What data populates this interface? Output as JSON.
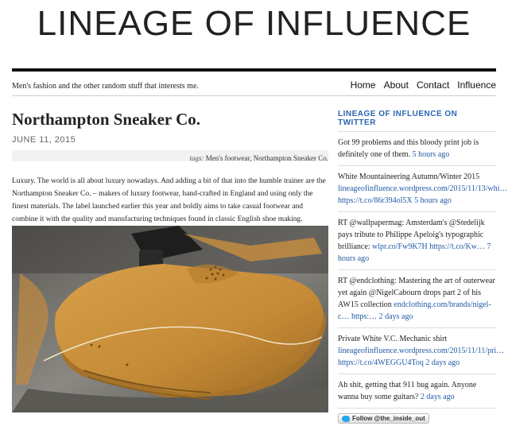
{
  "site": {
    "title": "LINEAGE OF INFLUENCE",
    "tagline": "Men's fashion and the other random stuff that interests me."
  },
  "nav": {
    "items": [
      "Home",
      "About",
      "Contact",
      "Influence"
    ]
  },
  "post": {
    "title": "Northampton Sneaker Co.",
    "date": "JUNE 11, 2015",
    "tags_label": "tags:",
    "tags": "Men's footwear, Northampton Sneaker Co.",
    "body": "Luxury. The world is all about luxury nowadays. And adding a bit of that into the humble trainer are the Northampton Sneaker Co. – makers of luxury footwear, hand-crafted in England and using only the finest materials. The label launched earlier this year and boldly aims to take casual footwear and combine it with the quality and manufacturing techniques found in classic English shoe making."
  },
  "sidebar": {
    "title": "LINEAGE OF INFLUENCE ON TWITTER",
    "tweets": [
      {
        "text": "Got 99 problems and this bloody print job is definitely one of them.",
        "link": "",
        "time": "5 hours ago"
      },
      {
        "text": "White Mountaineering Autumn/Winter 2015",
        "link": "lineageofinfluence.wordpress.com/2015/11/13/whi… https://t.co/86r394ol5X",
        "time": "5 hours ago"
      },
      {
        "text": "RT @wallpapermag: Amsterdam's @Stedelijk pays tribute to Philippe Apeloig's typographic brilliance:",
        "link": "wlpr.co/Fw9K7H https://t.co/Kw…",
        "time": "7 hours ago"
      },
      {
        "text": "RT @endclothing: Mastering the art of outerwear yet again @NigelCabourn drops part 2 of his AW15 collection",
        "link": "endclothing.com/brands/nigel-c… https:…",
        "time": "2 days ago"
      },
      {
        "text": "Private White V.C. Mechanic shirt",
        "link": "lineageofinfluence.wordpress.com/2015/11/11/pri… https://t.co/4WEGGU4Toq",
        "time": "2 days ago"
      },
      {
        "text": "Ah shit, getting that 911 bug again. Anyone wanna buy some guitars?",
        "link": "",
        "time": "2 days ago"
      }
    ],
    "follow_label": "Follow @the_inside_out"
  }
}
